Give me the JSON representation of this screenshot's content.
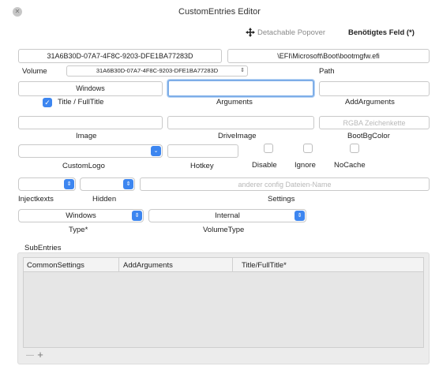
{
  "window": {
    "title": "CustomEntries Editor"
  },
  "header": {
    "detachable_label": "Detachable Popover",
    "required_label": "Benötigtes Feld (*)"
  },
  "volume_row": {
    "volume_value": "31A6B30D-07A7-4F8C-9203-DFE1BA77283D",
    "volume_label": "Volume",
    "volume_select": "31A6B30D-07A7-4F8C-9203-DFE1BA77283D",
    "path_value": "\\EFI\\Microsoft\\Boot\\bootmgfw.efi",
    "path_label": "Path"
  },
  "title_row": {
    "title_value": "Windows",
    "title_label": "Title / FullTitle",
    "title_checked": true,
    "arguments_value": "",
    "arguments_label": "Arguments",
    "add_arguments_value": "",
    "add_arguments_label": "AddArguments"
  },
  "image_row": {
    "image_label": "Image",
    "drive_image_label": "DriveImage",
    "boot_bg_placeholder": "RGBA Zeichenkette",
    "boot_bg_label": "BootBgColor"
  },
  "logo_row": {
    "custom_logo_label": "CustomLogo",
    "hotkey_label": "Hotkey",
    "disable_label": "Disable",
    "ignore_label": "Ignore",
    "nocache_label": "NoCache"
  },
  "inject_row": {
    "inject_kexts_label": "Injectkexts",
    "hidden_label": "Hidden",
    "settings_placeholder": "anderer config Dateien-Name",
    "settings_label": "Settings"
  },
  "type_row": {
    "type_value": "Windows",
    "type_label": "Type*",
    "volume_type_value": "Internal",
    "volume_type_label": "VolumeType"
  },
  "subentries": {
    "label": "SubEntries",
    "columns": [
      "CommonSettings",
      "AddArguments",
      "Title/FullTitle*"
    ],
    "add_symbol": "+",
    "remove_symbol": "—"
  },
  "icons": {
    "close": "close-icon",
    "move": "move-arrows-icon",
    "popup_arrow": "chevron-updown-icon"
  },
  "colors": {
    "accent": "#3d86f0",
    "focus": "#7eaee8"
  }
}
